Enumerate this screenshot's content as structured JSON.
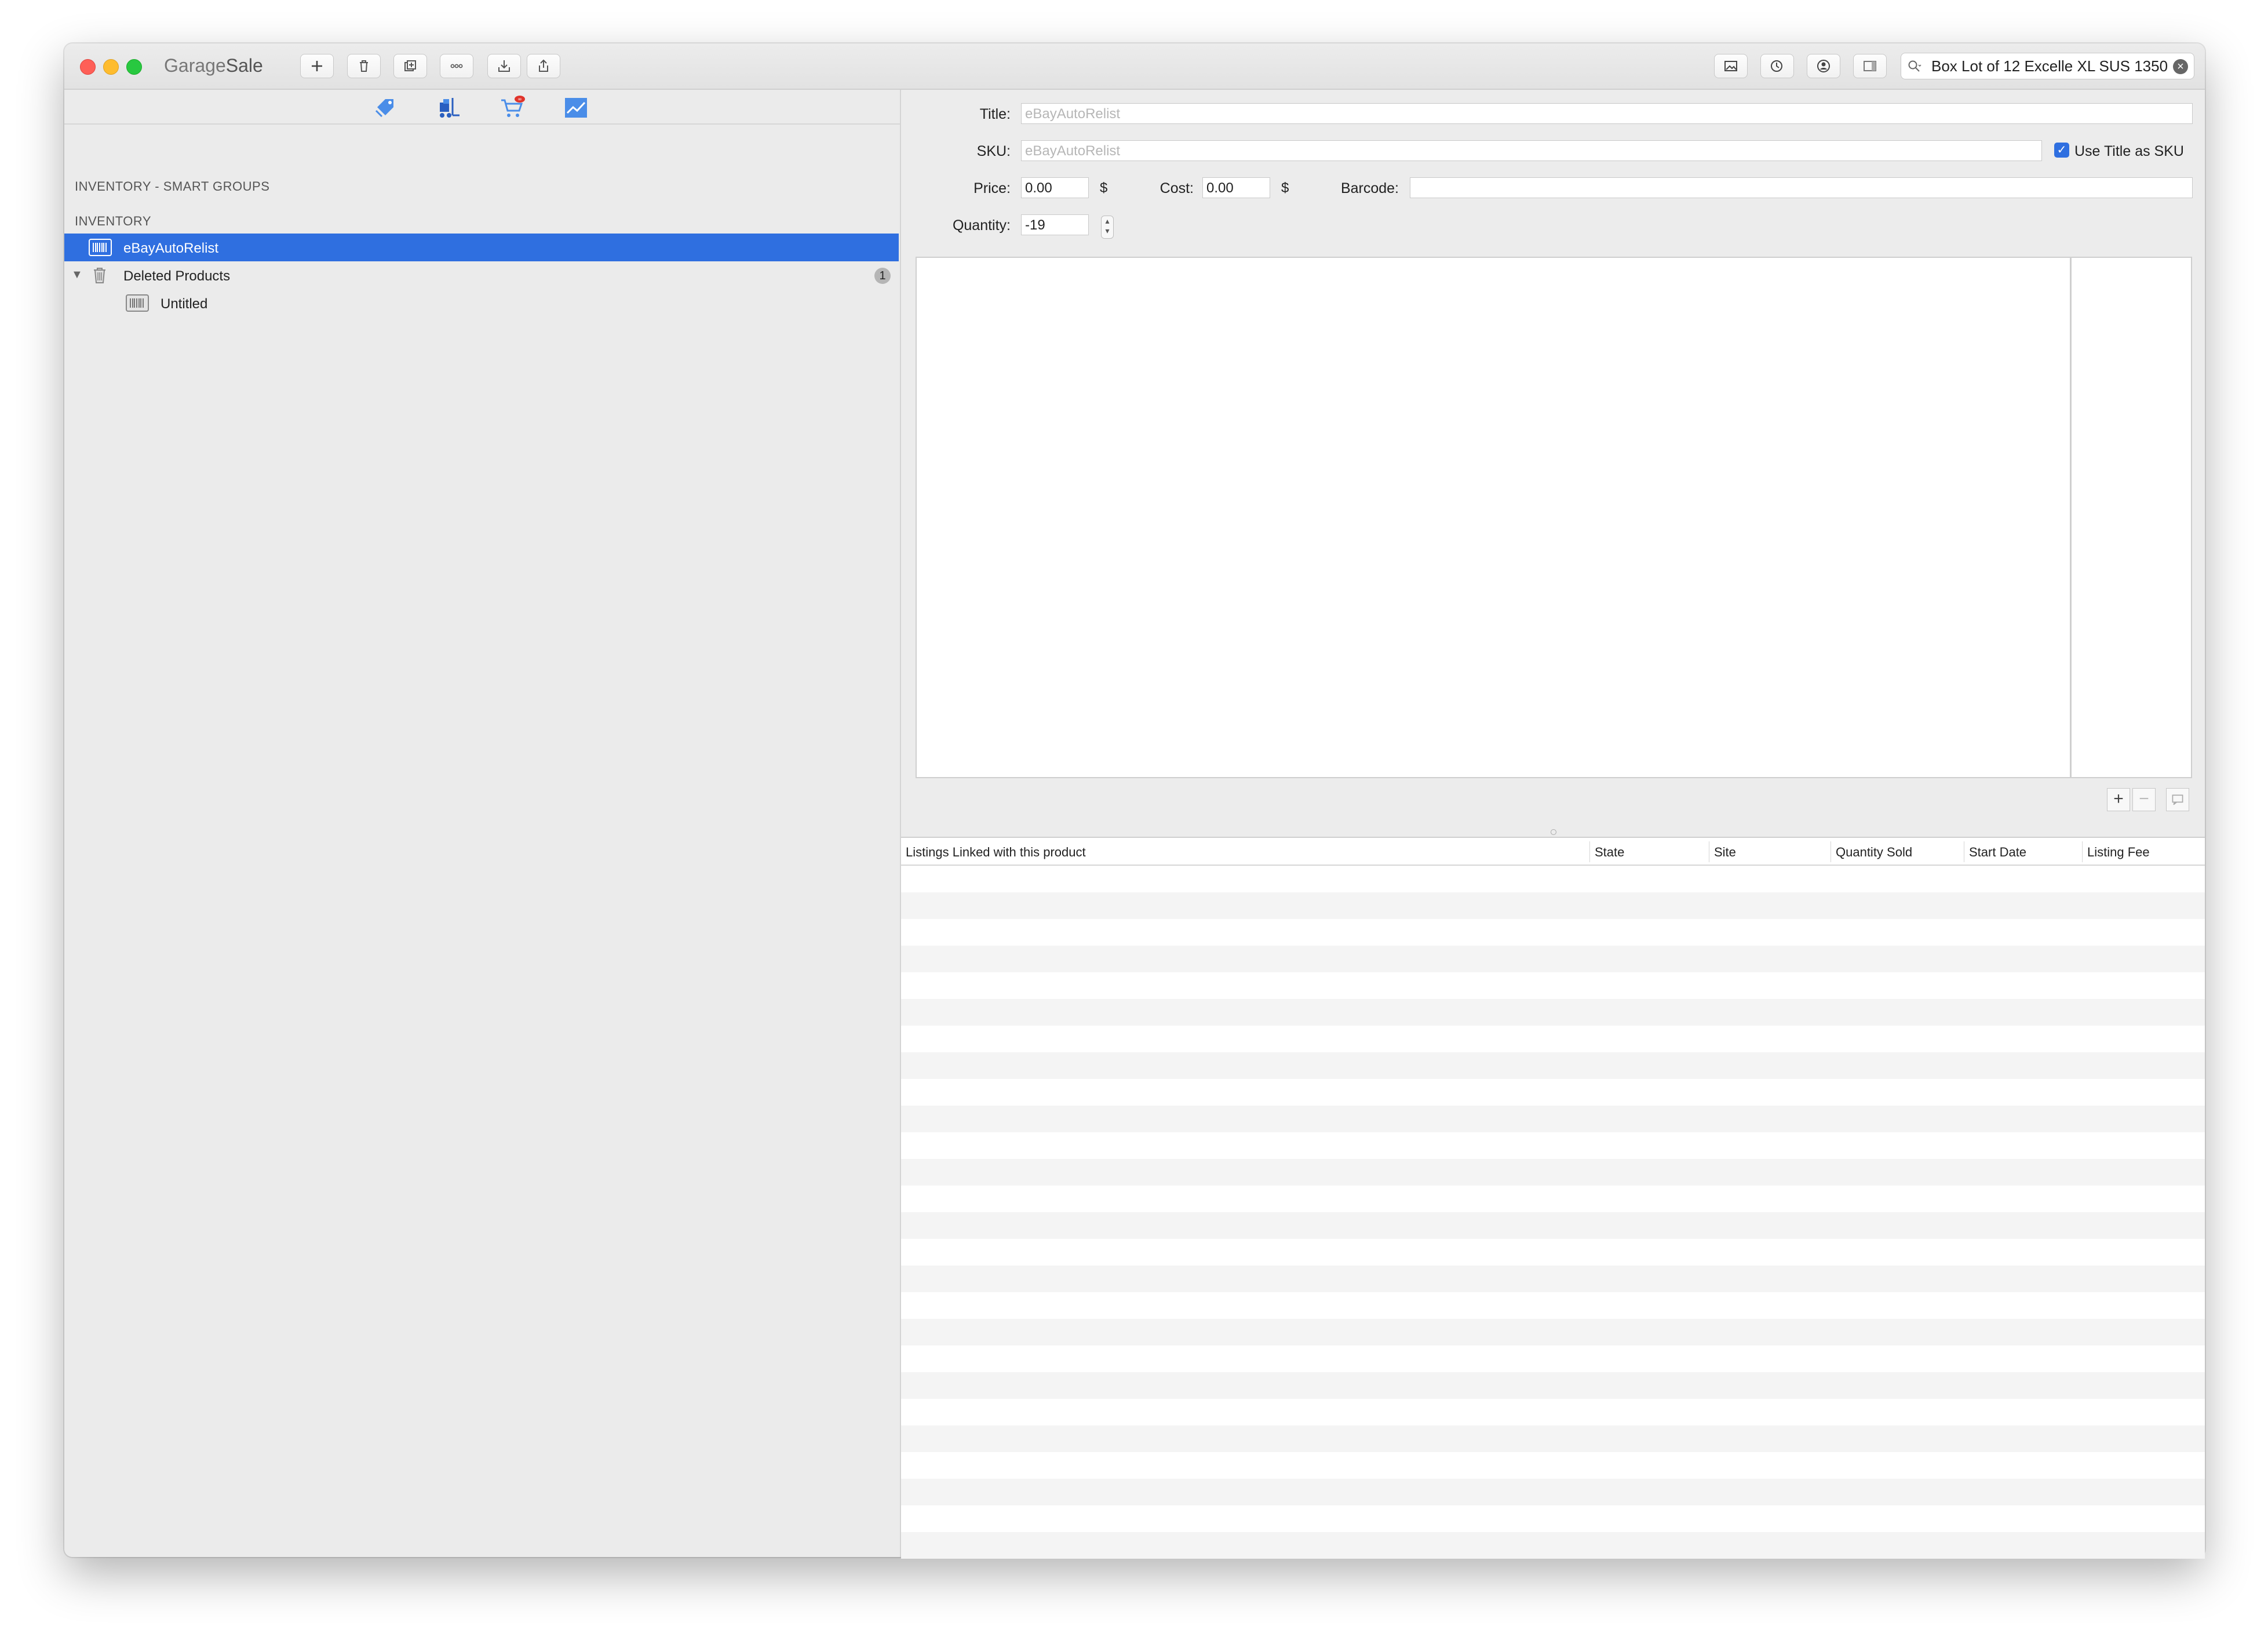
{
  "app": {
    "title_part1": "Garage",
    "title_part2": "Sale"
  },
  "toolbar": {
    "buttons": [
      {
        "name": "add-button",
        "icon": "plus-icon"
      },
      {
        "name": "delete-button",
        "icon": "trash-icon"
      },
      {
        "name": "duplicate-button",
        "icon": "duplicate-icon"
      },
      {
        "name": "more-button",
        "icon": "ellipsis-icon"
      },
      {
        "name": "import-button",
        "icon": "download-icon"
      },
      {
        "name": "share-button",
        "icon": "share-icon"
      }
    ],
    "right_buttons": [
      {
        "name": "gallery-button",
        "icon": "picture-icon"
      },
      {
        "name": "schedule-button",
        "icon": "clock-icon"
      },
      {
        "name": "account-button",
        "icon": "person-icon"
      },
      {
        "name": "toggle-panel-button",
        "icon": "sidebar-icon"
      }
    ]
  },
  "search": {
    "value": "Box Lot of 12 Excelle XL SUS 1350"
  },
  "sidebar": {
    "tabs": [
      {
        "name": "tab-listings",
        "icon": "tag-icon"
      },
      {
        "name": "tab-inventory",
        "icon": "forklift-icon"
      },
      {
        "name": "tab-orders",
        "icon": "cart-icon",
        "badge": "∞"
      },
      {
        "name": "tab-stats",
        "icon": "chart-icon"
      }
    ],
    "smart_groups_header": "INVENTORY - SMART GROUPS",
    "inventory_header": "INVENTORY",
    "items": [
      {
        "label": "eBayAutoRelist"
      },
      {
        "label": "Deleted Products",
        "badge": "1"
      },
      {
        "label": "Untitled"
      }
    ]
  },
  "form": {
    "title_label": "Title:",
    "title_placeholder": "eBayAutoRelist",
    "sku_label": "SKU:",
    "sku_placeholder": "eBayAutoRelist",
    "use_title_as_sku": "Use Title as SKU",
    "price_label": "Price:",
    "price_value": "0.00",
    "currency": "$",
    "cost_label": "Cost:",
    "cost_value": "0.00",
    "barcode_label": "Barcode:",
    "barcode_value": "",
    "quantity_label": "Quantity:",
    "quantity_value": "-19"
  },
  "table": {
    "columns": [
      "Listings Linked with this product",
      "State",
      "Site",
      "Quantity Sold",
      "Start Date",
      "Listing Fee"
    ]
  }
}
